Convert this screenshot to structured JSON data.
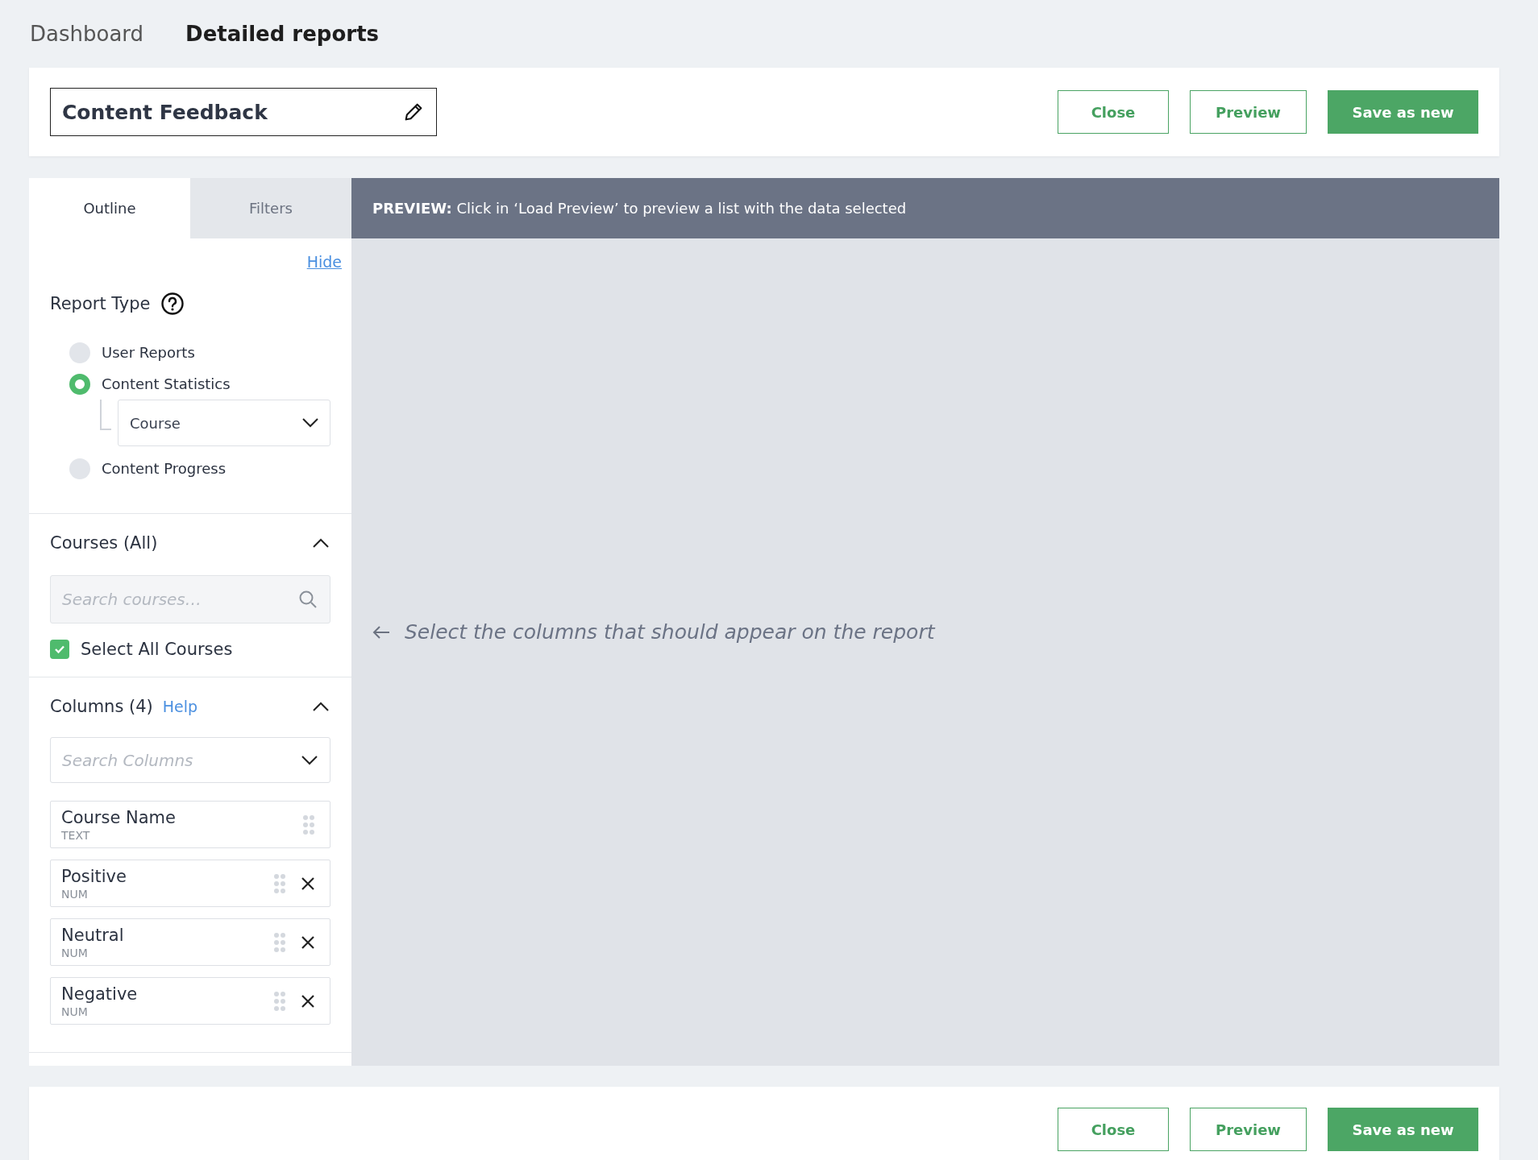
{
  "top_tabs": [
    {
      "label": "Dashboard",
      "selected": false
    },
    {
      "label": "Detailed reports",
      "selected": true
    }
  ],
  "report_name": {
    "value": "Content Feedback"
  },
  "header_buttons": [
    {
      "label": "Close",
      "kind": "outline"
    },
    {
      "label": "Preview",
      "kind": "outline"
    },
    {
      "label": "Save as new",
      "kind": "primary"
    }
  ],
  "panel_tabs": [
    {
      "label": "Outline",
      "selected": true
    },
    {
      "label": "Filters",
      "selected": false
    }
  ],
  "hide_link": "Hide",
  "report_type": {
    "title": "Report Type",
    "options": [
      {
        "label": "User Reports",
        "selected": false
      },
      {
        "label": "Content Statistics",
        "selected": true,
        "dropdown": {
          "value": "Course"
        }
      },
      {
        "label": "Content Progress",
        "selected": false
      }
    ]
  },
  "courses": {
    "title": "Courses (All)",
    "expanded": true,
    "search": {
      "placeholder": "Search courses…"
    },
    "select_all": {
      "label": "Select All Courses",
      "checked": true
    }
  },
  "columns": {
    "title": "Columns (4)",
    "help": "Help",
    "expanded": true,
    "search": {
      "placeholder": "Search Columns"
    },
    "items": [
      {
        "name": "Course Name",
        "type": "TEXT",
        "removable": false
      },
      {
        "name": "Positive",
        "type": "NUM",
        "removable": true
      },
      {
        "name": "Neutral",
        "type": "NUM",
        "removable": true
      },
      {
        "name": "Negative",
        "type": "NUM",
        "removable": true
      }
    ]
  },
  "preview": {
    "banner_label": "PREVIEW:",
    "banner_text": "Click in ‘Load Preview’ to preview a list with the data selected",
    "message": "Select the columns that should appear on the report"
  },
  "footer_buttons": [
    {
      "label": "Close",
      "kind": "outline"
    },
    {
      "label": "Preview",
      "kind": "outline"
    },
    {
      "label": "Save as new",
      "kind": "primary"
    }
  ]
}
